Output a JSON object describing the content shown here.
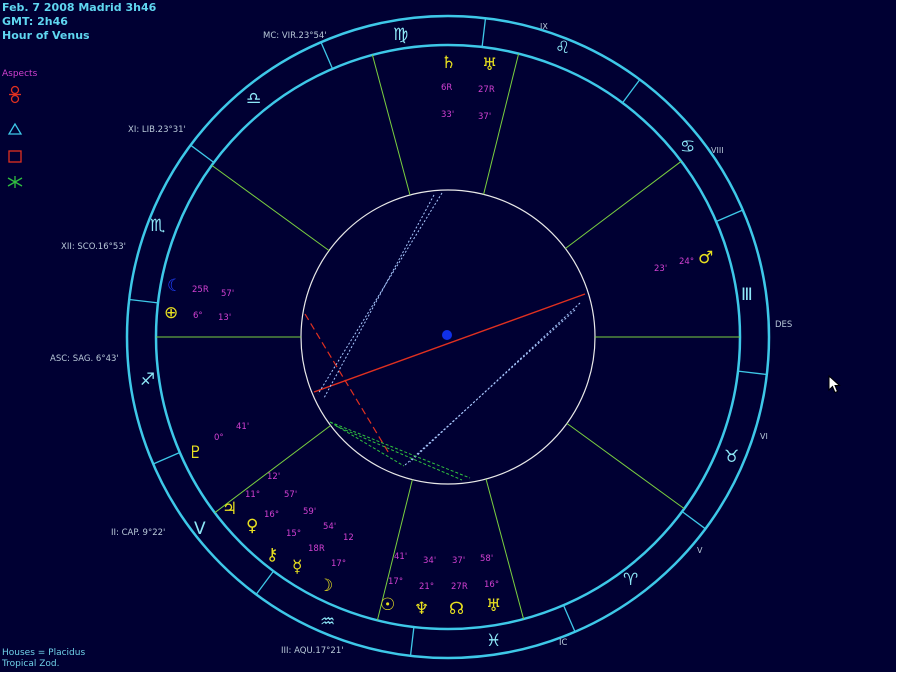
{
  "header": {
    "line1": "Feb. 7 2008 Madrid  3h46",
    "line2": "GMT: 2h46",
    "line3": "Hour of Venus"
  },
  "aspects_legend": {
    "title": "Aspects",
    "items": [
      {
        "icon": "opposition-icon",
        "symbol": "☍",
        "color": "#e03020"
      },
      {
        "icon": "trine-icon",
        "symbol": "△",
        "color": "#3ec8e8"
      },
      {
        "icon": "square-icon",
        "symbol": "□",
        "color": "#e03020"
      },
      {
        "icon": "sextile-icon",
        "symbol": "✶",
        "color": "#30c040"
      }
    ]
  },
  "footer": {
    "houses": "Houses = Placidus",
    "zodiac": "Tropical Zod."
  },
  "cusps": {
    "mc": "MC: VIR.23°54'",
    "xi": "XI: LIB.23°31'",
    "xii": "XII: SCO.16°53'",
    "asc": "ASC: SAG. 6°43'",
    "ii": "II: CAP. 9°22'",
    "iii": "III: AQU.17°21'"
  },
  "angles": {
    "des": "DES",
    "ic": "IC"
  },
  "house_numbers": {
    "ix": "IX",
    "viii": "VIII",
    "vi": "VI",
    "v": "V"
  },
  "zodiac_signs": {
    "virgo": "♍",
    "leo": "♌",
    "cancer": "♋",
    "gemini": "Ⅲ",
    "taurus": "♉",
    "aries": "♈",
    "pisces": "♓",
    "aquarius": "♒",
    "capricorn": "Ⅴ",
    "sagittarius": "♐",
    "scorpio": "♏",
    "libra": "♎"
  },
  "planets": {
    "saturn": {
      "glyph": "♄",
      "deg": "6R",
      "min": "33'"
    },
    "uranus_top": {
      "glyph": "♅",
      "deg": "27R",
      "min": "37'"
    },
    "mars": {
      "glyph": "♂",
      "deg": "24°",
      "min": "23'"
    },
    "moon": {
      "glyph": "☾",
      "deg": "25R",
      "min": "57'"
    },
    "earth": {
      "glyph": "⊕",
      "deg": "6°",
      "min": "13'"
    },
    "pluto": {
      "glyph": "♇",
      "deg": "0°",
      "min": "41'"
    },
    "jupiter": {
      "glyph": "♃",
      "deg": "11°",
      "min": "12'"
    },
    "venus": {
      "glyph": "♀",
      "deg": "16°",
      "min": "57'"
    },
    "chiron": {
      "glyph": "⚷",
      "deg": "15°",
      "min": "59'"
    },
    "mercury": {
      "glyph": "☿",
      "deg": "18R",
      "min": "54'"
    },
    "moon2": {
      "glyph": "☽",
      "deg": "17°",
      "min": "12"
    },
    "sun": {
      "glyph": "☉",
      "deg": "17°",
      "min": "41'"
    },
    "neptune": {
      "glyph": "♆",
      "deg": "21°",
      "min": "34'"
    },
    "node": {
      "glyph": "☊",
      "deg": "27R",
      "min": "37'"
    },
    "uranus": {
      "glyph": "♅",
      "deg": "16°",
      "min": "58'"
    }
  },
  "colors": {
    "background": "#000033",
    "wheel": "#3ec8e8",
    "cusp_line": "#7ad040",
    "planet": "#e8e020",
    "degree_text": "#d040d0",
    "opposition": "#e03020",
    "trine": "#3ec8e8",
    "center_dot": "#1030e8"
  }
}
